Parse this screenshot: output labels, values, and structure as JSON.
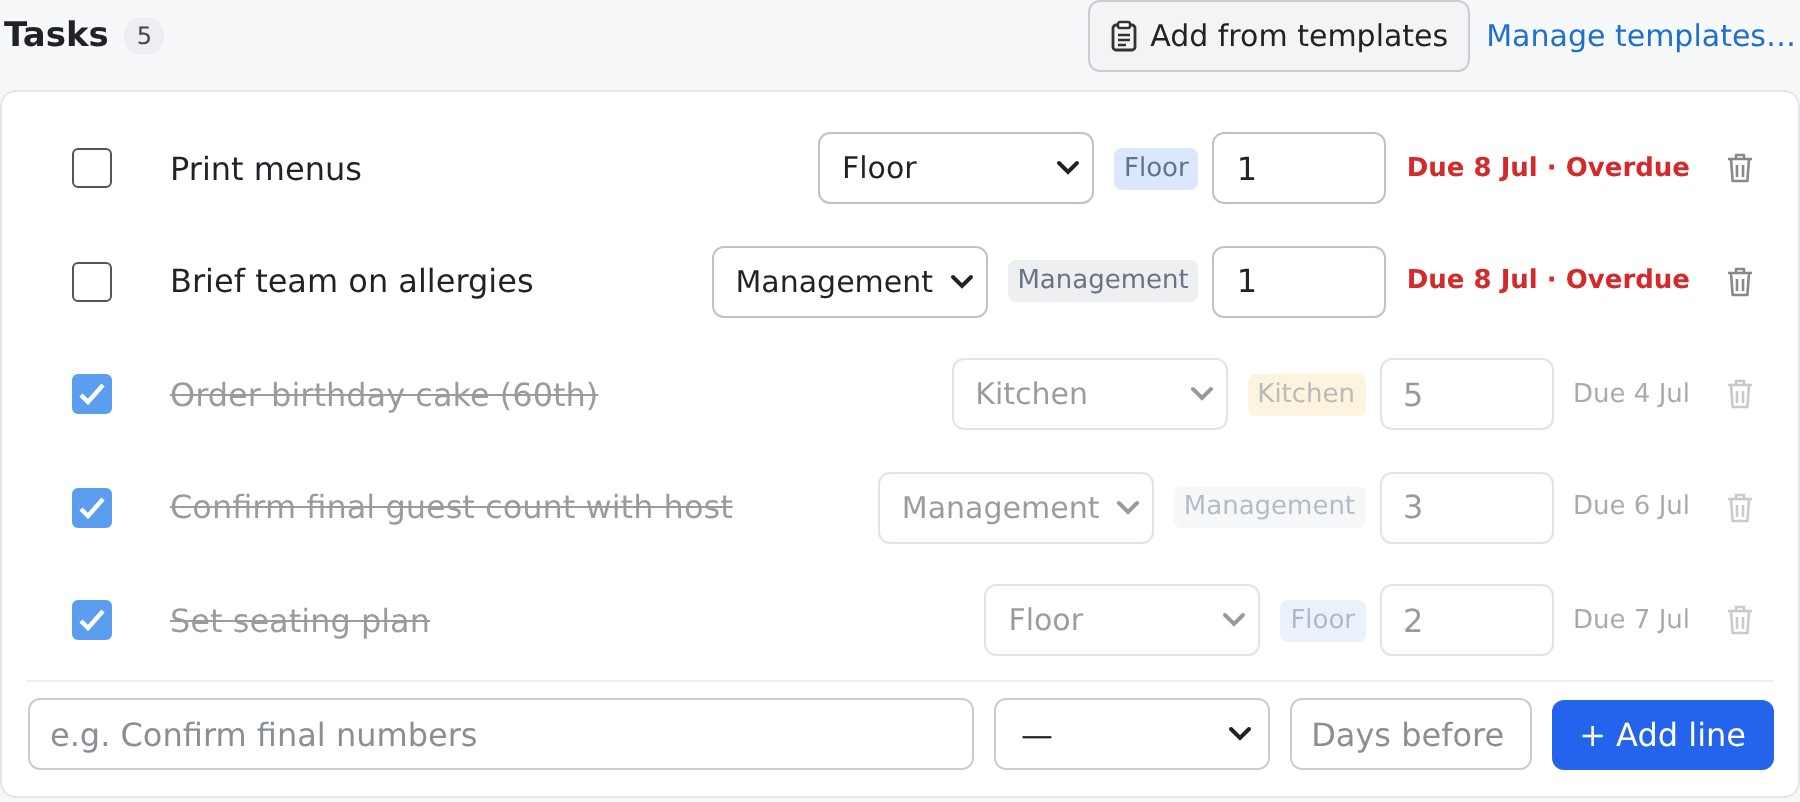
{
  "header": {
    "title": "Tasks",
    "count": "5",
    "template_button": "Add from templates",
    "manage_link": "Manage templates…"
  },
  "tasks": [
    {
      "title": "Print menus",
      "checked": false,
      "team": "Floor",
      "tag": {
        "label": "Floor",
        "color": "#dbe8fb"
      },
      "days": "1",
      "due": "Due 8 Jul · Overdue",
      "overdue": true
    },
    {
      "title": "Brief team on allergies",
      "checked": false,
      "team": "Management",
      "tag": {
        "label": "Management",
        "color": "#eeeff1"
      },
      "days": "1",
      "due": "Due 8 Jul · Overdue",
      "overdue": true
    },
    {
      "title": "Order birthday cake (60th)",
      "checked": true,
      "team": "Kitchen",
      "tag": {
        "label": "Kitchen",
        "color": "#fdf4dd"
      },
      "days": "5",
      "due": "Due 4 Jul",
      "overdue": false
    },
    {
      "title": "Confirm final guest count with host",
      "checked": true,
      "team": "Management",
      "tag": {
        "label": "Management",
        "color": "#f6f7f8"
      },
      "days": "3",
      "due": "Due 6 Jul",
      "overdue": false
    },
    {
      "title": "Set seating plan",
      "checked": true,
      "team": "Floor",
      "tag": {
        "label": "Floor",
        "color": "#ecf2fd"
      },
      "days": "2",
      "due": "Due 7 Jul",
      "overdue": false
    }
  ],
  "add_form": {
    "task_placeholder": "e.g. Confirm final numbers",
    "team": "—",
    "days_placeholder": "Days before",
    "button": "+ Add line"
  }
}
